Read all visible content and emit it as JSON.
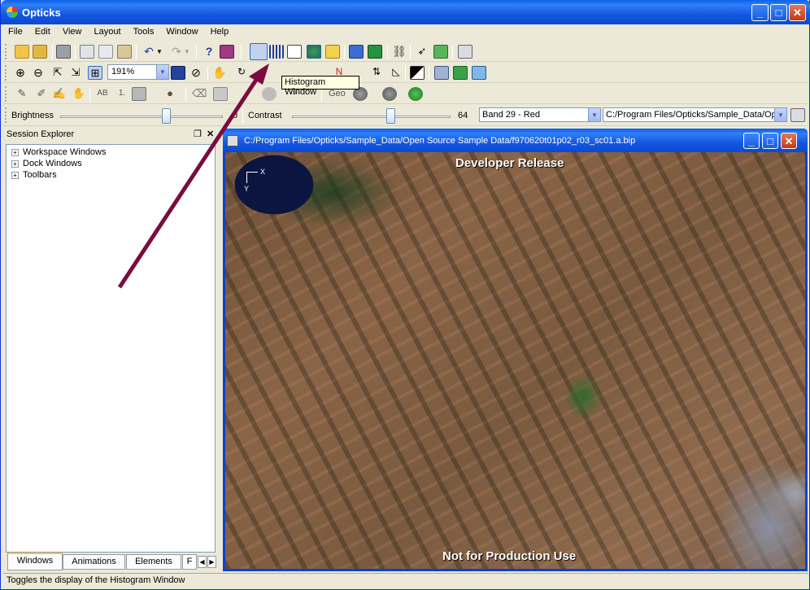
{
  "app": {
    "title": "Opticks"
  },
  "menu": [
    "File",
    "Edit",
    "View",
    "Layout",
    "Tools",
    "Window",
    "Help"
  ],
  "toolbar": {
    "zoom_value": "191%",
    "tooltip": "Histogram Window",
    "geo_label": "Geo"
  },
  "adjust": {
    "brightness_label": "Brightness",
    "brightness_value": "0",
    "contrast_label": "Contrast",
    "contrast_value": "64",
    "band_select": "Band 29 - Red",
    "path_select": "C:/Program Files/Opticks/Sample_Data/Ope"
  },
  "session": {
    "title": "Session Explorer",
    "items": [
      "Workspace Windows",
      "Dock Windows",
      "Toolbars"
    ],
    "tabs": [
      "Windows",
      "Animations",
      "Elements",
      "F"
    ]
  },
  "image_window": {
    "title": "C:/Program Files/Opticks/Sample_Data/Open Source Sample Data/f970620t01p02_r03_sc01.a.bip",
    "watermark_top": "Developer Release",
    "watermark_bottom": "Not for Production Use",
    "axis_x": "X",
    "axis_y": "Y"
  },
  "status": {
    "text": "Toggles the display of the Histogram Window"
  },
  "colors": {
    "titlebar": "#0a5fee",
    "annotation_arrow": "#7a0c3f",
    "tooltip_bg": "#ffffe1"
  }
}
